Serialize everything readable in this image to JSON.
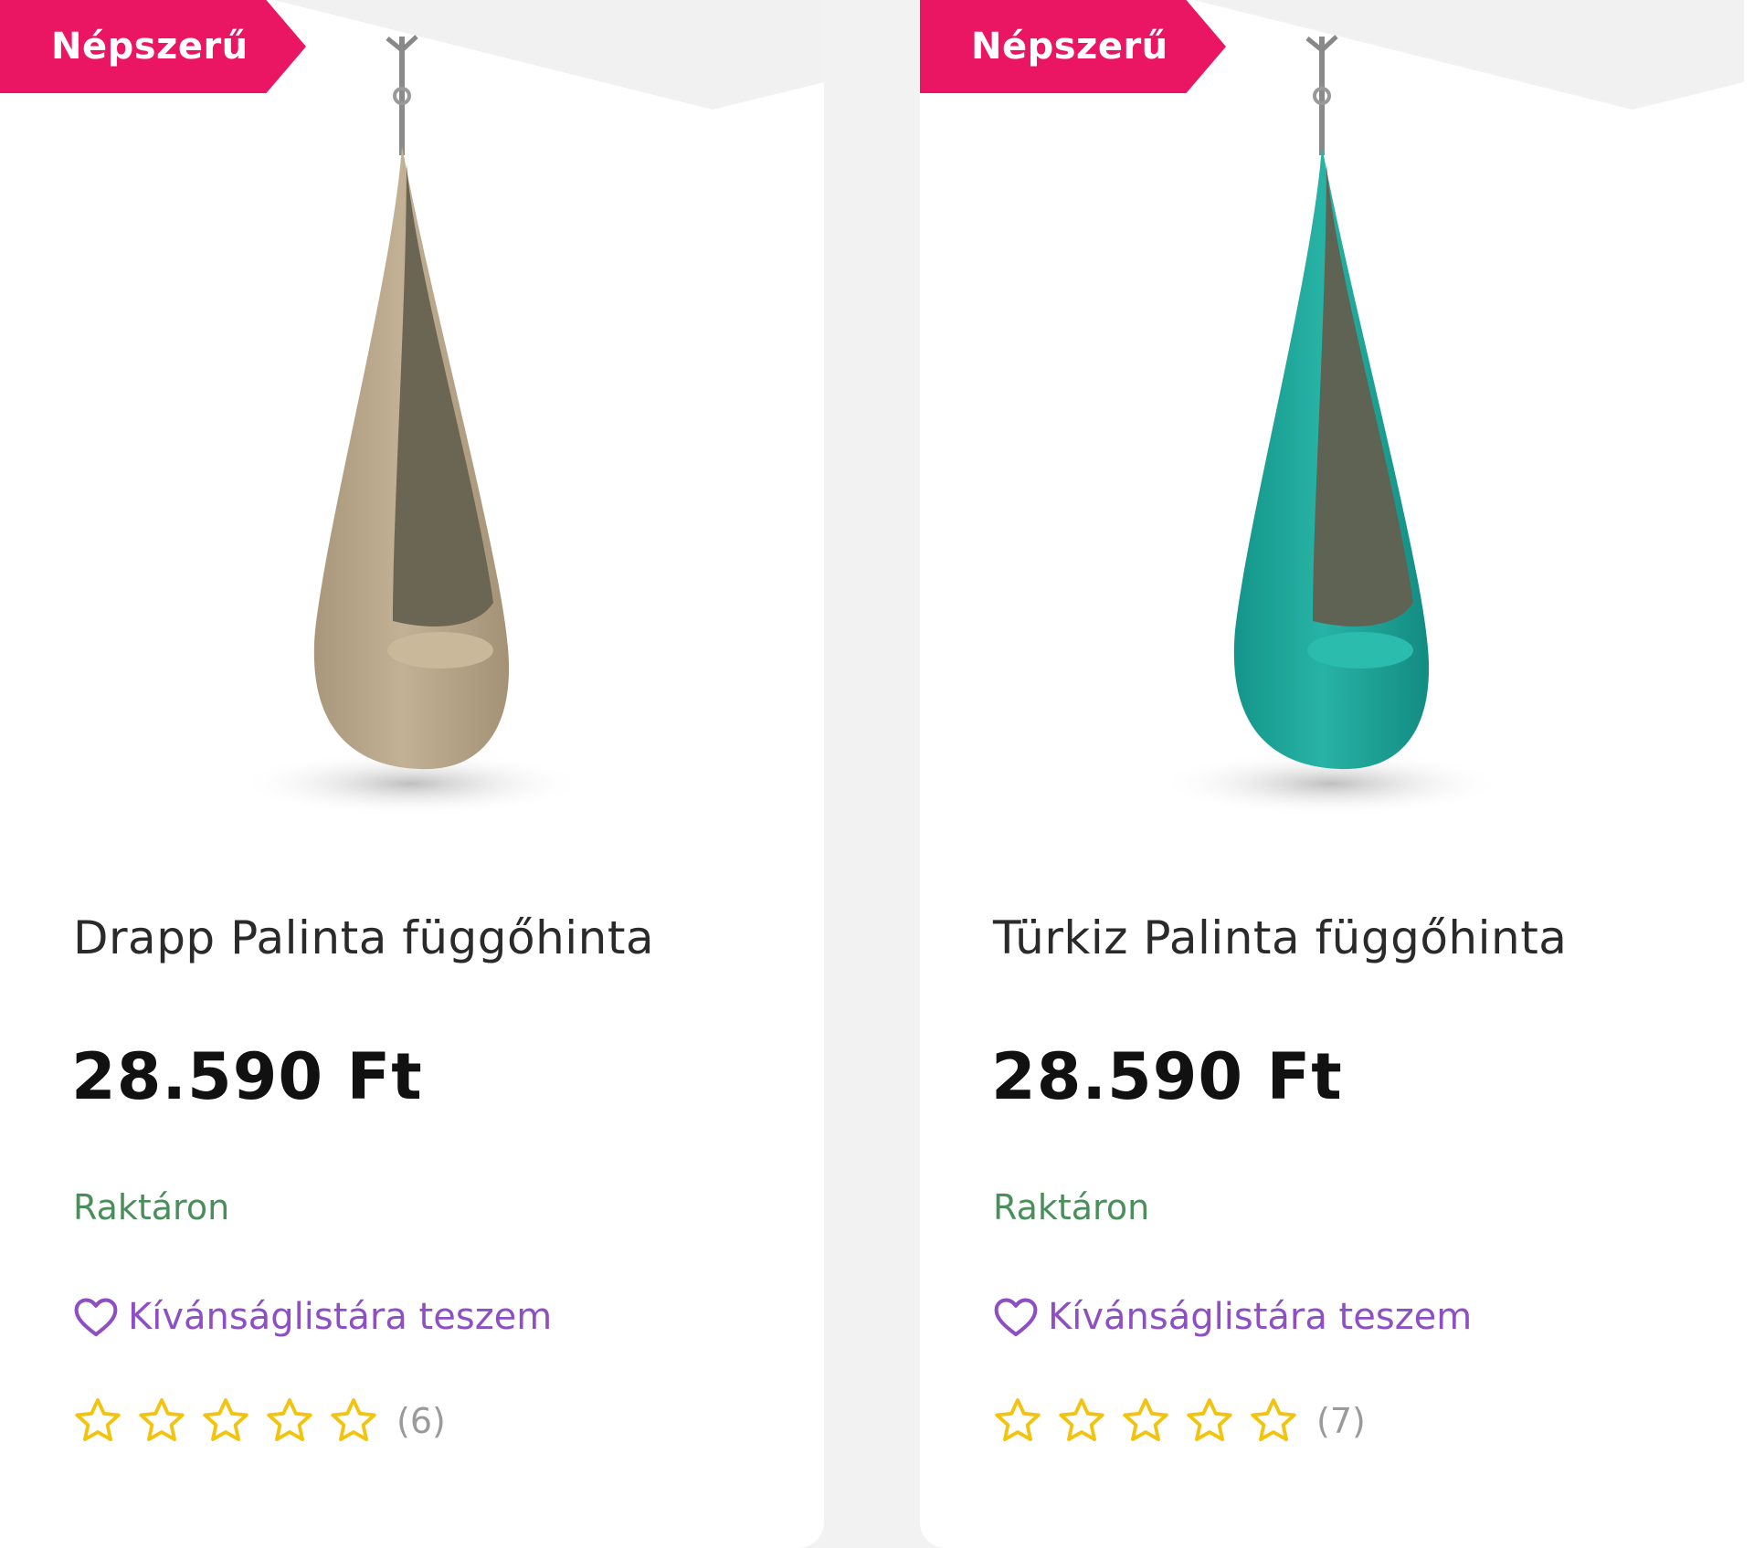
{
  "products": [
    {
      "badge": "Népszerű",
      "title": "Drapp Palinta függőhinta",
      "price": "28.590 Ft",
      "stock": "Raktáron",
      "wishlist_label": "Kívánságlistára teszem",
      "rating": 0,
      "review_count": "(6)",
      "swing_color": "#b6a58a"
    },
    {
      "badge": "Népszerű",
      "title": "Türkiz Palinta függőhinta",
      "price": "28.590 Ft",
      "stock": "Raktáron",
      "wishlist_label": "Kívánságlistára teszem",
      "rating": 0,
      "review_count": "(7)",
      "swing_color": "#1fa79a"
    }
  ],
  "colors": {
    "badge": "#ea1663",
    "stock": "#4a8e5c",
    "wishlist": "#8e4fc4",
    "star": "#f2c40f"
  },
  "icons": {
    "wishlist": "heart-icon",
    "rating": "star-icon"
  }
}
